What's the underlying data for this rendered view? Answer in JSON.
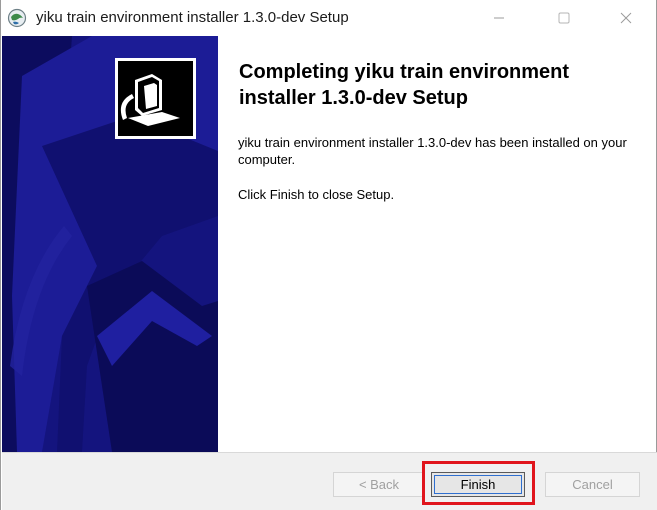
{
  "window": {
    "title": "yiku train environment installer 1.3.0-dev Setup"
  },
  "content": {
    "heading": "Completing yiku train environment installer 1.3.0-dev Setup",
    "paragraph1": "yiku train environment installer 1.3.0-dev has been installed on your computer.",
    "paragraph2": "Click Finish to close Setup."
  },
  "buttons": {
    "back_label": "< Back",
    "finish_label": "Finish",
    "cancel_label": "Cancel"
  },
  "colors": {
    "banner_dark": "#0a0a5c",
    "banner_mid": "#1a1a8f",
    "highlight": "#e0141c"
  },
  "icons": {
    "app": "installer-globe-icon",
    "banner": "computer-install-icon"
  }
}
